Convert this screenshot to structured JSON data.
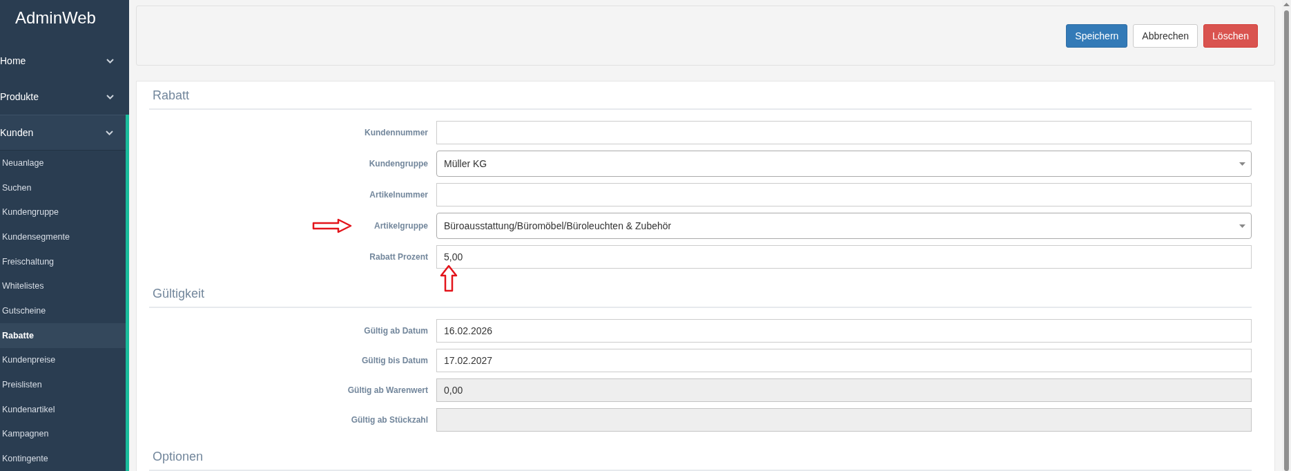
{
  "sidebar": {
    "brand": "AdminWeb",
    "items": [
      {
        "label": "Home",
        "expanded": false
      },
      {
        "label": "Produkte",
        "expanded": false
      },
      {
        "label": "Kunden",
        "expanded": true,
        "children": [
          {
            "label": "Neuanlage",
            "selected": false
          },
          {
            "label": "Suchen",
            "selected": false
          },
          {
            "label": "Kundengruppe",
            "selected": false
          },
          {
            "label": "Kundensegmente",
            "selected": false
          },
          {
            "label": "Freischaltung",
            "selected": false
          },
          {
            "label": "Whitelistes",
            "selected": false
          },
          {
            "label": "Gutscheine",
            "selected": false
          },
          {
            "label": "Rabatte",
            "selected": true
          },
          {
            "label": "Kundenpreise",
            "selected": false
          },
          {
            "label": "Preislisten",
            "selected": false
          },
          {
            "label": "Kundenartikel",
            "selected": false
          },
          {
            "label": "Kampagnen",
            "selected": false
          },
          {
            "label": "Kontingente",
            "selected": false
          }
        ]
      }
    ]
  },
  "toolbar": {
    "buttons": [
      {
        "label": "Speichern",
        "kind": "primary"
      },
      {
        "label": "Abbrechen",
        "kind": "default"
      },
      {
        "label": "Löschen",
        "kind": "danger"
      }
    ]
  },
  "sections": [
    {
      "title": "Rabatt",
      "fields": [
        {
          "label": "Kundennummer",
          "kind": "input",
          "disabled": false
        },
        {
          "label": "Kundengruppe",
          "kind": "select",
          "value": "Müller KG",
          "disabled": false
        },
        {
          "label": "Artikelnummer",
          "kind": "input",
          "disabled": false
        },
        {
          "label": "Artikelgruppe",
          "kind": "select",
          "value": "Büroausstattung/Büromöbel/Büroleuchten & Zubehör",
          "disabled": false,
          "arrow_before_label": true
        },
        {
          "label": "Rabatt Prozent",
          "kind": "input",
          "value": "5,00",
          "disabled": false,
          "arrow_below_field": true
        }
      ]
    },
    {
      "title": "Gültigkeit",
      "fields": [
        {
          "label": "Gültig ab Datum",
          "kind": "input",
          "value": "16.02.2026",
          "disabled": false
        },
        {
          "label": "Gültig bis Datum",
          "kind": "input",
          "value": "17.02.2027",
          "disabled": false
        },
        {
          "label": "Gültig ab Warenwert",
          "kind": "input",
          "value": "0,00",
          "disabled": true
        },
        {
          "label": "Gültig ab Stückzahl",
          "kind": "input",
          "disabled": true
        }
      ]
    },
    {
      "title": "Optionen"
    }
  ]
}
